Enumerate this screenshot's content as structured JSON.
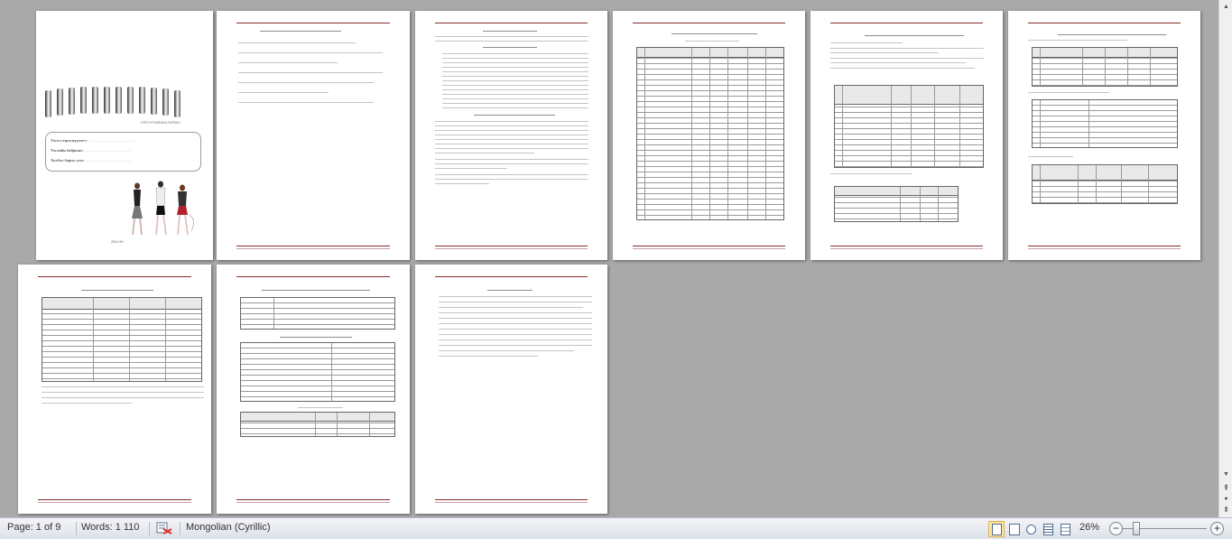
{
  "statusbar": {
    "page_label": "Page: 1 of 9",
    "words_label": "Words: 1 110",
    "language_label": "Mongolian (Cyrillic)",
    "zoom_label": "26%",
    "zoom_percent": 26,
    "zoom_out_glyph": "−",
    "zoom_in_glyph": "+",
    "spellcheck_icon": "spellcheck-icon",
    "view_icons": [
      "print-layout-icon",
      "full-screen-reading-icon",
      "web-layout-icon",
      "outline-icon",
      "draft-icon"
    ]
  },
  "scrollbar": {
    "up_glyph": "▲",
    "down_glyph": "▼",
    "prev_page_glyph": "⇞",
    "select_browse_glyph": "●",
    "next_page_glyph": "⇟"
  },
  "cover": {
    "caption": "УУРГУУР БАЙЛАГА ГАРЛАГО",
    "field1": "Төсөл хэрэгжүүлэгч:",
    "field2": "Төслийн байршил:",
    "field3": "Холбоо барих утас:",
    "dots": "……………………………",
    "footer": "2014 ОН"
  },
  "colors": {
    "accent": "#8a2b2b",
    "workspace": "#a9a9a9"
  }
}
